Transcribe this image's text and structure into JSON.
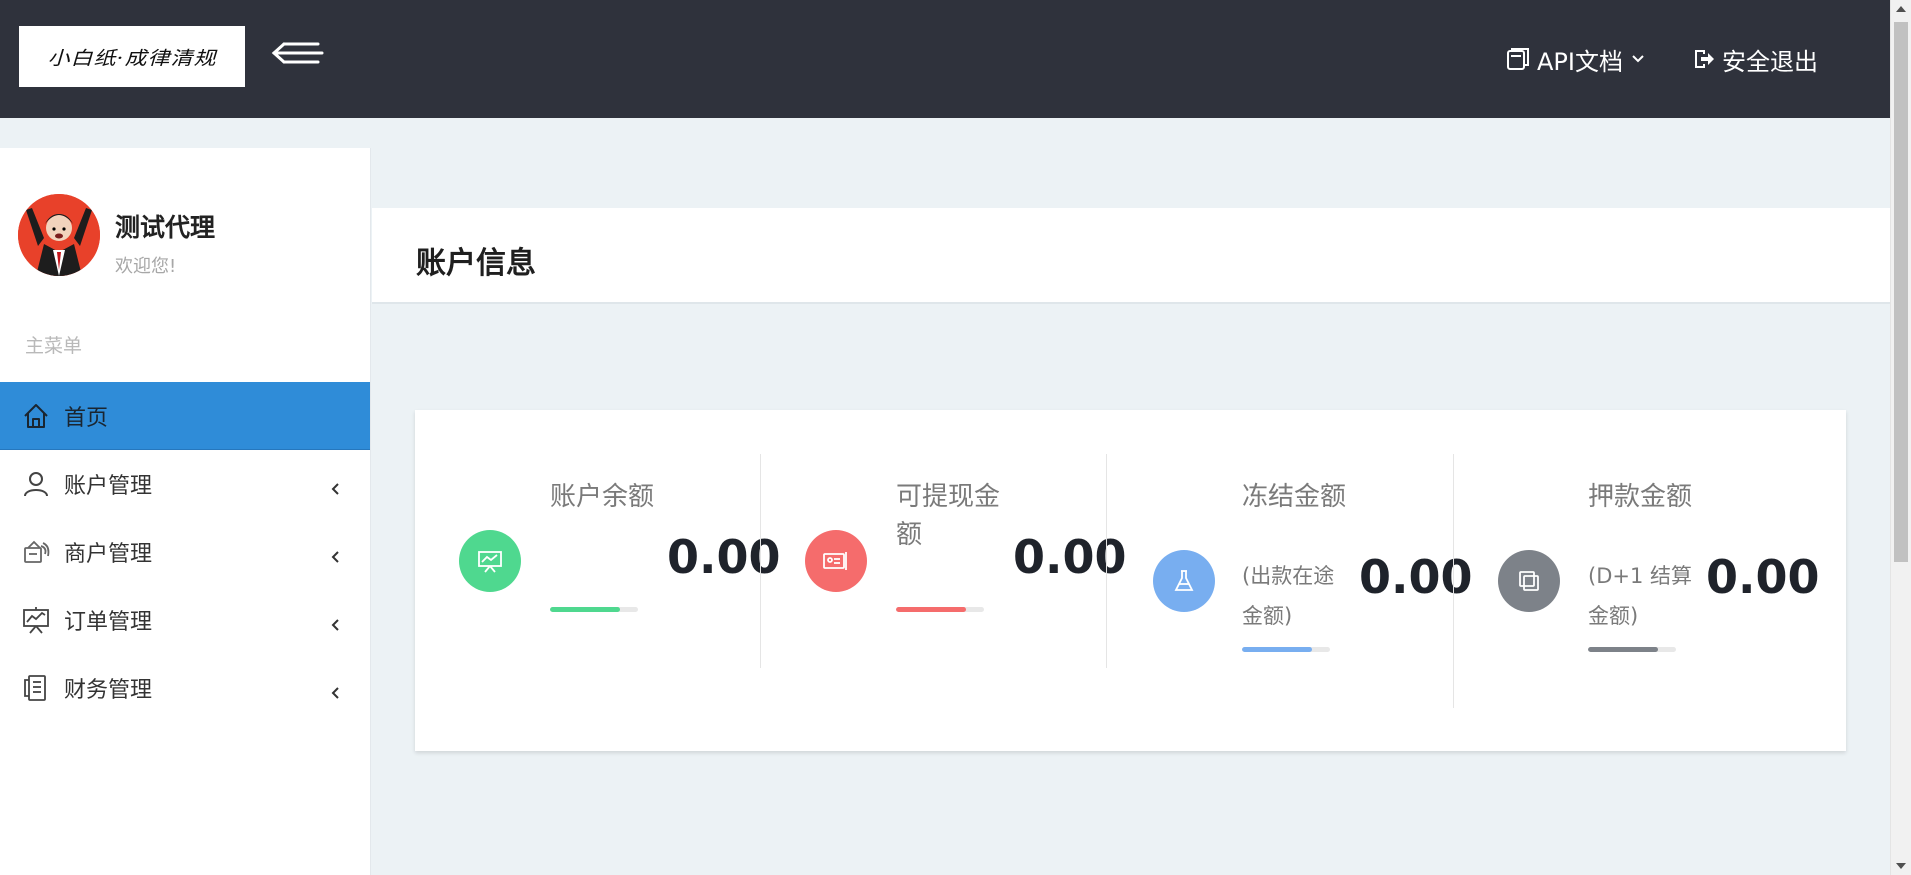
{
  "header": {
    "logo_text": "小白纸·成律清规",
    "api_docs_label": "API文档",
    "logout_label": "安全退出"
  },
  "sidebar": {
    "user_name": "测试代理",
    "welcome": "欢迎您!",
    "menu_heading": "主菜单",
    "items": [
      {
        "label": "首页",
        "icon": "home-icon",
        "active": true
      },
      {
        "label": "账户管理",
        "icon": "user-icon",
        "has_submenu": true
      },
      {
        "label": "商户管理",
        "icon": "merchant-icon",
        "has_submenu": true
      },
      {
        "label": "订单管理",
        "icon": "order-icon",
        "has_submenu": true
      },
      {
        "label": "财务管理",
        "icon": "finance-icon",
        "has_submenu": true
      }
    ]
  },
  "main": {
    "title": "账户信息",
    "stats": [
      {
        "label": "账户余额",
        "sub": "",
        "value": "0.00",
        "color": "#4fd88f",
        "icon": "chart-board-icon",
        "progress": 0.8
      },
      {
        "label": "可提现金额",
        "sub": "",
        "value": "0.00",
        "color": "#f56c6c",
        "icon": "id-card-icon",
        "progress": 0.8
      },
      {
        "label": "冻结金额",
        "sub": "(出款在途金额)",
        "value": "0.00",
        "color": "#78aef0",
        "icon": "flask-icon",
        "progress": 0.8
      },
      {
        "label": "押款金额",
        "sub": "(D+1 结算金额)",
        "value": "0.00",
        "color": "#7d8289",
        "icon": "copy-window-icon",
        "progress": 0.8
      }
    ]
  },
  "colors": {
    "topbar": "#2f323c",
    "active_menu": "#2f8cd8",
    "page_bg": "#ecf2f5"
  }
}
